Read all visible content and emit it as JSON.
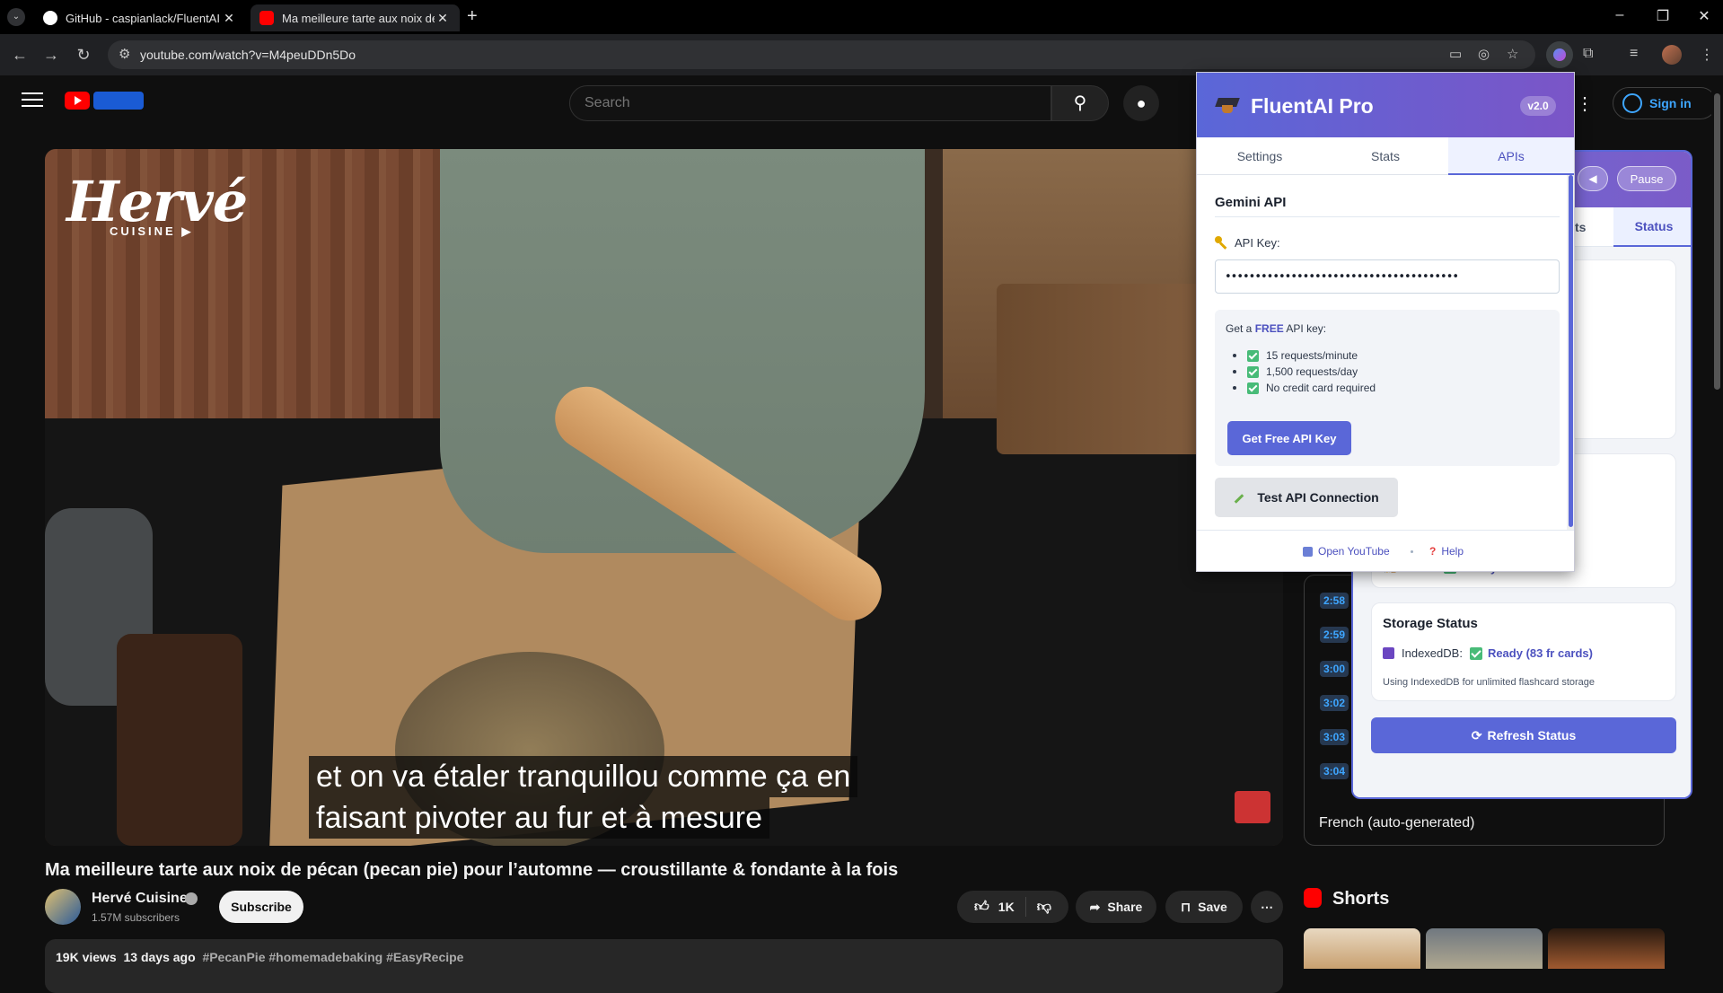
{
  "browser": {
    "tabs": [
      {
        "title": "GitHub - caspianlack/FluentAI: ",
        "close": "✕"
      },
      {
        "title": "Ma meilleure tarte aux noix de ",
        "close": "✕"
      }
    ],
    "new_tab": "+",
    "url": "youtube.com/watch?v=M4peuDDn5Do",
    "window_controls": {
      "minimize": "–",
      "restore": "❐",
      "close": "✕"
    },
    "nav": {
      "back": "←",
      "forward": "→",
      "reload": "↻"
    }
  },
  "youtube": {
    "search_placeholder": "Search",
    "sign_in": "Sign in",
    "video": {
      "logo": "Hervé",
      "logo_sub": "CUISINE ▶",
      "subtitles": [
        "et on va étaler tranquillou comme ça en",
        "faisant pivoter au fur et à mesure"
      ]
    },
    "title": "Ma meilleure tarte aux noix de pécan (pecan pie) pour l’automne — croustillante & fondante à la fois",
    "channel": {
      "name": "Hervé Cuisine",
      "subscribers": "1.57M subscribers",
      "subscribe": "Subscribe"
    },
    "actions": {
      "likes": "1K",
      "share": "Share",
      "save": "Save",
      "more": "⋯"
    },
    "description": {
      "views": "19K views",
      "age": "13 days ago",
      "tags": "#PecanPie #homemadebaking #EasyRecipe"
    },
    "transcript": {
      "timestamps": [
        "2:58",
        "2:59",
        "3:00",
        "3:02",
        "3:03",
        "3:04"
      ],
      "language": "French (auto-generated)"
    },
    "shorts_title": "Shorts"
  },
  "overlay": {
    "back": "◀",
    "pause": "Pause",
    "tab_partial": "ts",
    "tab_status": "Status",
    "writer_label": "Writer:",
    "writer_status": "Ready",
    "storage_title": "Storage Status",
    "indexeddb_label": "IndexedDB:",
    "indexeddb_status": "Ready (83 fr cards)",
    "storage_note": "Using IndexedDB for unlimited flashcard storage",
    "refresh": "Refresh Status"
  },
  "popup": {
    "title": "FluentAI Pro",
    "version": "v2.0",
    "tabs": [
      "Settings",
      "Stats",
      "APIs"
    ],
    "section_title": "Gemini API",
    "api_key_label": "API Key:",
    "api_key_value": "•••••••••••••••••••••••••••••••••••••••",
    "free_prefix": "Get a",
    "free_word": "FREE",
    "free_suffix": "API key:",
    "benefits": [
      "15 requests/minute",
      "1,500 requests/day",
      "No credit card required"
    ],
    "get_key": "Get Free API Key",
    "test_connection": "Test API Connection",
    "footer": {
      "open_youtube": "Open YouTube",
      "help": "Help"
    }
  },
  "colors": {
    "accent": "#5a67d8",
    "brand_red": "#ff0000",
    "check_green": "#48bb78"
  }
}
